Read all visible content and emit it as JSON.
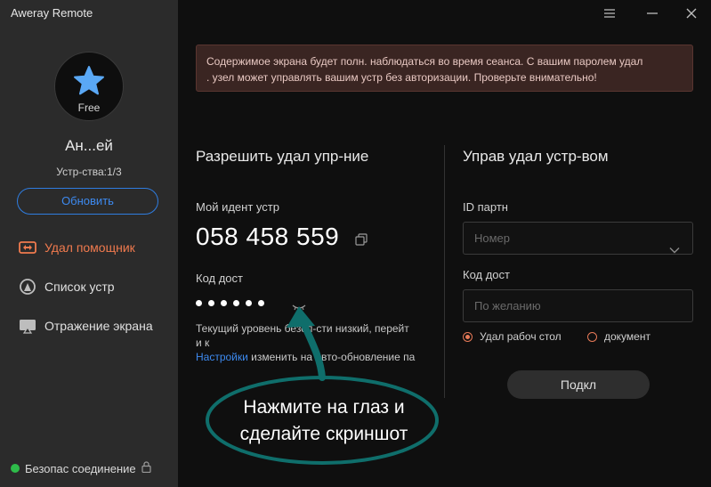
{
  "app": {
    "title": "Aweray Remote"
  },
  "sidebar": {
    "plan_badge": "Free",
    "user_name": "Ан...ей",
    "devices": "Устр-ства:1/3",
    "upgrade_label": "Обновить",
    "nav": [
      {
        "label": "Удал помощник",
        "icon": "remote-assist-icon",
        "active": true
      },
      {
        "label": "Список устр",
        "icon": "device-list-icon",
        "active": false
      },
      {
        "label": "Отражение экрана",
        "icon": "screen-mirror-icon",
        "active": false
      }
    ],
    "status": "Безопас соединение"
  },
  "notice": {
    "line1": "Содержимое экрана будет полн. наблюдаться во время сеанса. С вашим паролем удал",
    "line2": ". узел может управлять вашим устр без авторизации. Проверьте внимательно!"
  },
  "allow": {
    "title": "Разрешить удал упр-ние",
    "device_id_label": "Мой идент устр",
    "device_id": "058 458 559",
    "access_code_label": "Код дост",
    "hint_line1": "Текущий уровень безоп-сти низкий, перейт",
    "hint_line2": "и к",
    "hint_link": "Настройки",
    "hint_line3": " изменить на авто-обновление па"
  },
  "control": {
    "title": "Управ удал устр-вом",
    "partner_id_label": "ID партн",
    "partner_id_placeholder": "Номер",
    "access_code_label": "Код дост",
    "access_code_placeholder": "По желанию",
    "mode_desktop": "Удал рабоч стол",
    "mode_document": "документ",
    "connect_label": "Подкл"
  },
  "annotation": {
    "line1": "Нажмите на глаз и",
    "line2": "сделайте скриншот"
  },
  "colors": {
    "accent": "#f07a4e",
    "link": "#3d8af0",
    "secure_dot": "#2ebc4a",
    "annotation_stroke": "#0f6e6b"
  }
}
